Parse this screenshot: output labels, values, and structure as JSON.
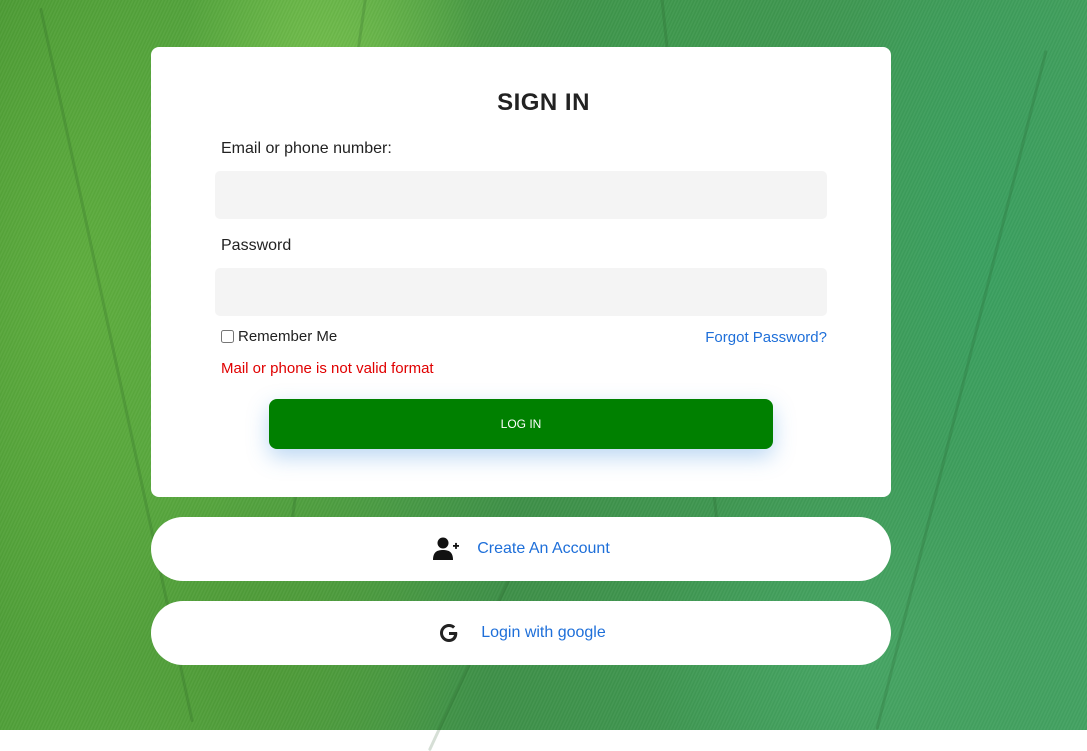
{
  "form": {
    "title": "SIGN IN",
    "email_label": "Email or phone number:",
    "email_value": "",
    "password_label": "Password",
    "password_value": "",
    "remember_label": "Remember Me",
    "remember_checked": false,
    "forgot_link": "Forgot Password?",
    "error_message": "Mail or phone is not valid format",
    "login_button": "LOG IN"
  },
  "actions": {
    "create_account": {
      "label": "Create An Account",
      "icon": "add-user-icon"
    },
    "google_login": {
      "label": "Login with google",
      "icon": "google-icon"
    }
  },
  "colors": {
    "login_button": "#008000",
    "error": "#e00000",
    "link": "#1e6fd9"
  }
}
